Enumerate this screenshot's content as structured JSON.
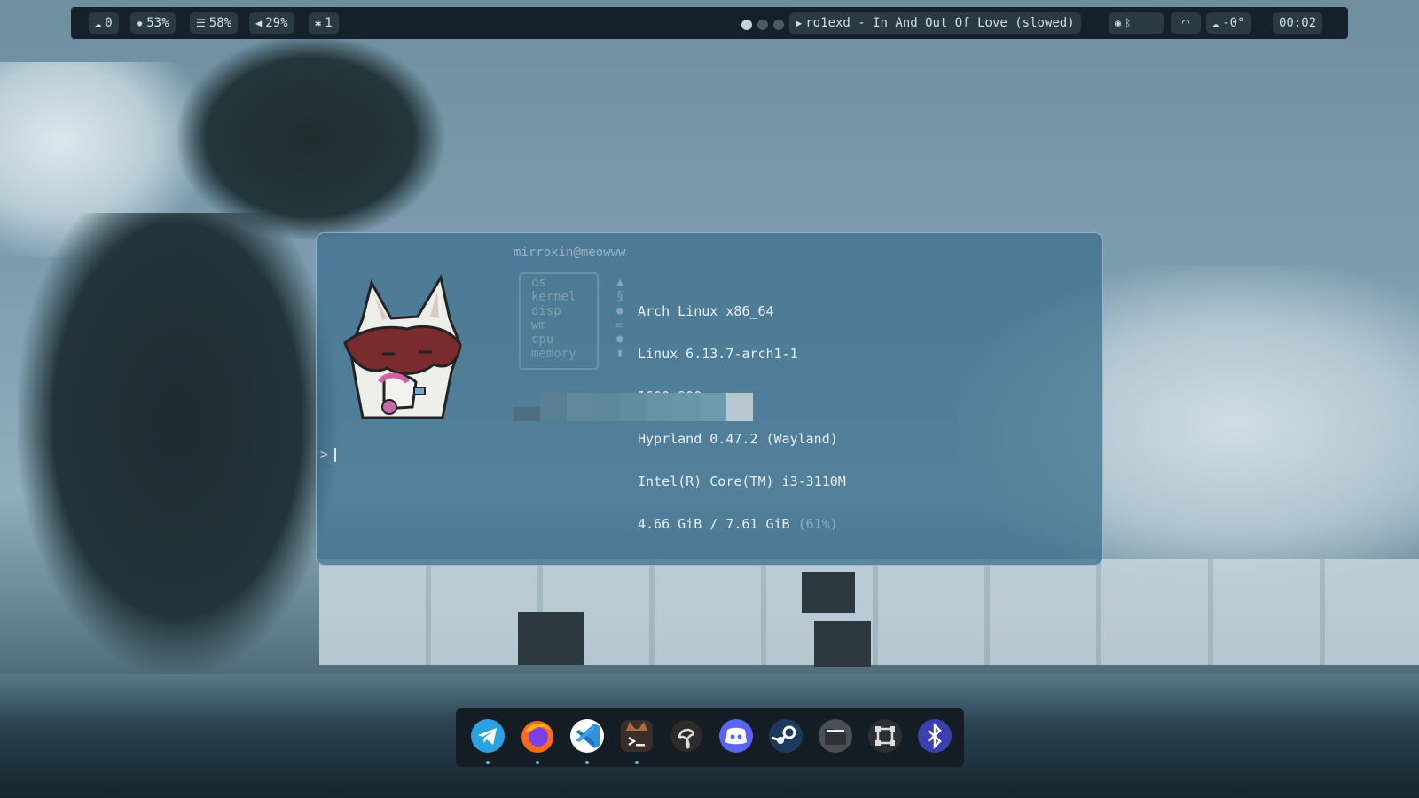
{
  "topbar": {
    "cloud": "0",
    "cpu": "53%",
    "memory": "58%",
    "volume": "29%",
    "bluetooth": "1",
    "workspaces": [
      {
        "active": true
      },
      {
        "active": false
      },
      {
        "active": false
      },
      {
        "active": false
      }
    ],
    "media": "ro1exd - In And Out Of Love (slowed)",
    "weather": "-0°",
    "clock": "00:02"
  },
  "terminal": {
    "userhost": "mirroxin@meowww",
    "fetch": [
      {
        "key": "os",
        "value": "Arch Linux x86_64"
      },
      {
        "key": "kernel",
        "value": "Linux 6.13.7-arch1-1"
      },
      {
        "key": "disp",
        "value": "1600x900"
      },
      {
        "key": "wm",
        "value": "Hyprland 0.47.2 (Wayland)"
      },
      {
        "key": "cpu",
        "value": "Intel(R) Core(TM) i3-3110M"
      },
      {
        "key": "memory",
        "value": "4.66 GiB / 7.61 GiB ",
        "extra": "(61%)"
      }
    ],
    "palette": [
      "#4e6f7f",
      "#5a7f92",
      "#61889b",
      "#5e8799",
      "#628ca0",
      "#6791a4",
      "#6b96a9",
      "#6f9aad",
      "#b8c8d0"
    ],
    "prompt_symbol": ">"
  },
  "dock": {
    "apps": [
      {
        "name": "telegram",
        "color": "#2aa3e0",
        "running": true
      },
      {
        "name": "firefox",
        "color": "#ff7a1a",
        "running": true
      },
      {
        "name": "vscode",
        "color": "#2f8fd8",
        "running": true
      },
      {
        "name": "terminal",
        "color": "#3a2e2a",
        "running": true
      },
      {
        "name": "obs",
        "color": "#2b2b2b",
        "running": false
      },
      {
        "name": "discord",
        "color": "#5865f2",
        "running": false
      },
      {
        "name": "steam",
        "color": "#1b3a5c",
        "running": false
      },
      {
        "name": "files",
        "color": "#3a3f44",
        "running": false
      },
      {
        "name": "screenshot",
        "color": "#2b2f33",
        "running": false
      },
      {
        "name": "bluetooth",
        "color": "#3c3fb0",
        "running": false
      }
    ]
  }
}
